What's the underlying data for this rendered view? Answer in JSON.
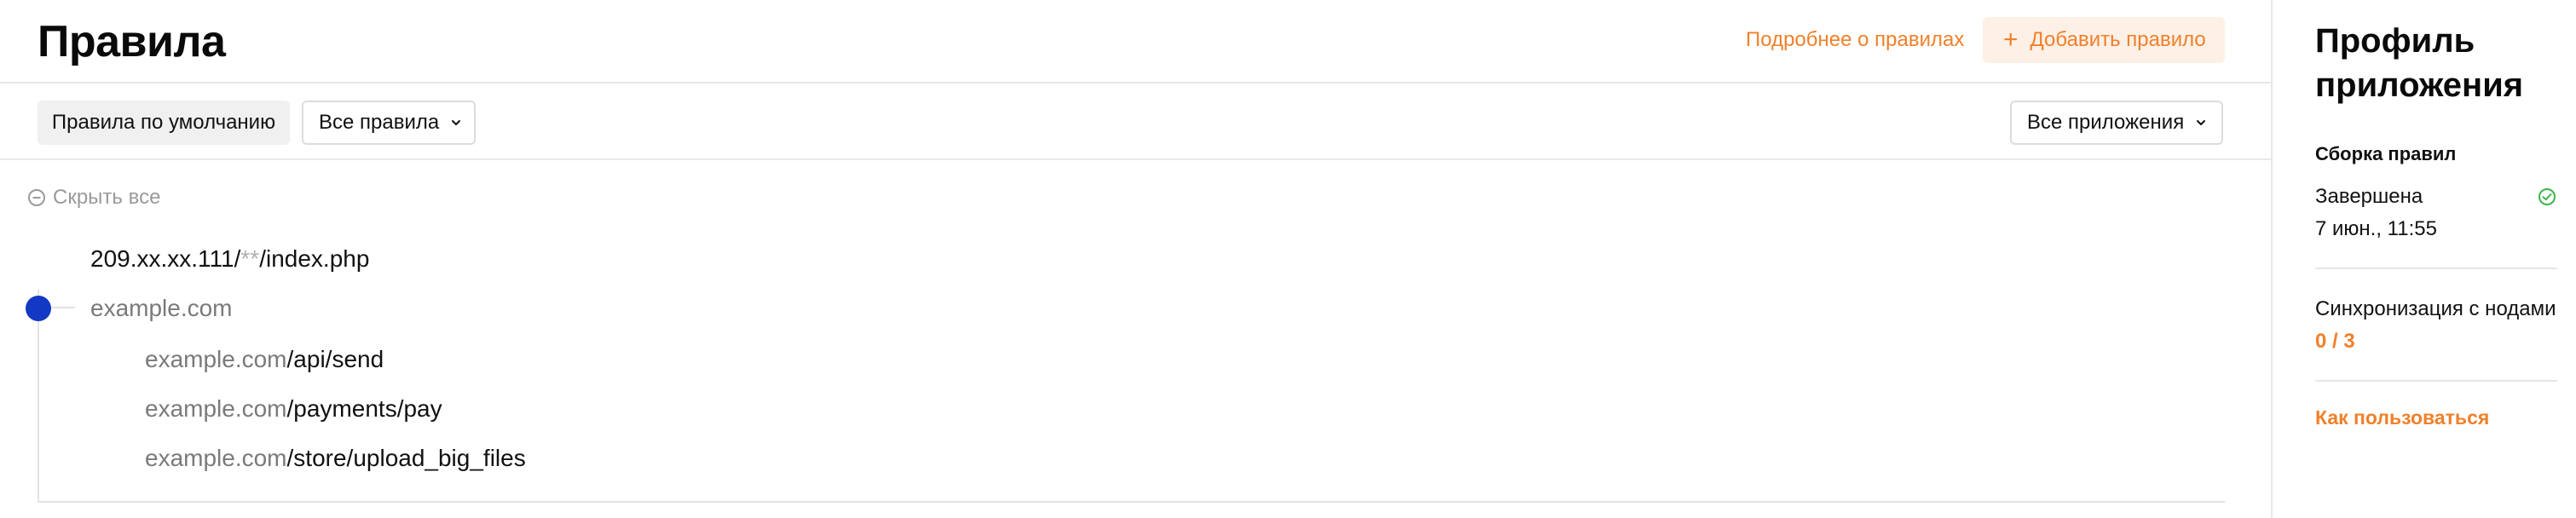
{
  "header": {
    "title": "Правила",
    "more_link": "Подробнее о правилах",
    "add_button": "Добавить правило"
  },
  "toolbar": {
    "default_rules": "Правила по умолчанию",
    "rules_filter": "Все правила",
    "apps_filter": "Все приложения"
  },
  "tree": {
    "collapse_all": "Скрыть все",
    "rule_ip": {
      "prefix": "209.xx.xx.111/",
      "wildcard": "**",
      "suffix": "/index.php"
    },
    "domain": "example.com",
    "children": [
      {
        "domain": "example.com",
        "path": "/api/send"
      },
      {
        "domain": "example.com",
        "path": "/payments/pay"
      },
      {
        "domain": "example.com",
        "path": "/store/upload_big_files"
      }
    ]
  },
  "panel": {
    "title": "Профиль приложения",
    "build_heading": "Сборка правил",
    "build_status": "Завершена",
    "build_date": "7 июн., 11:55",
    "sync_label": "Синхронизация с нодами",
    "sync_count": "0 / 3",
    "howto_link": "Как пользоваться"
  },
  "colors": {
    "accent": "#f0802a",
    "accent_bg": "#fdf0e6",
    "node_dot": "#1238c4",
    "success": "#3fb34f",
    "muted_text": "#7a7a7a"
  },
  "icons": {
    "add": "plus-icon",
    "dropdown": "chevron-down-icon",
    "collapse": "minus-circle-icon",
    "status": "check-circle-icon"
  }
}
